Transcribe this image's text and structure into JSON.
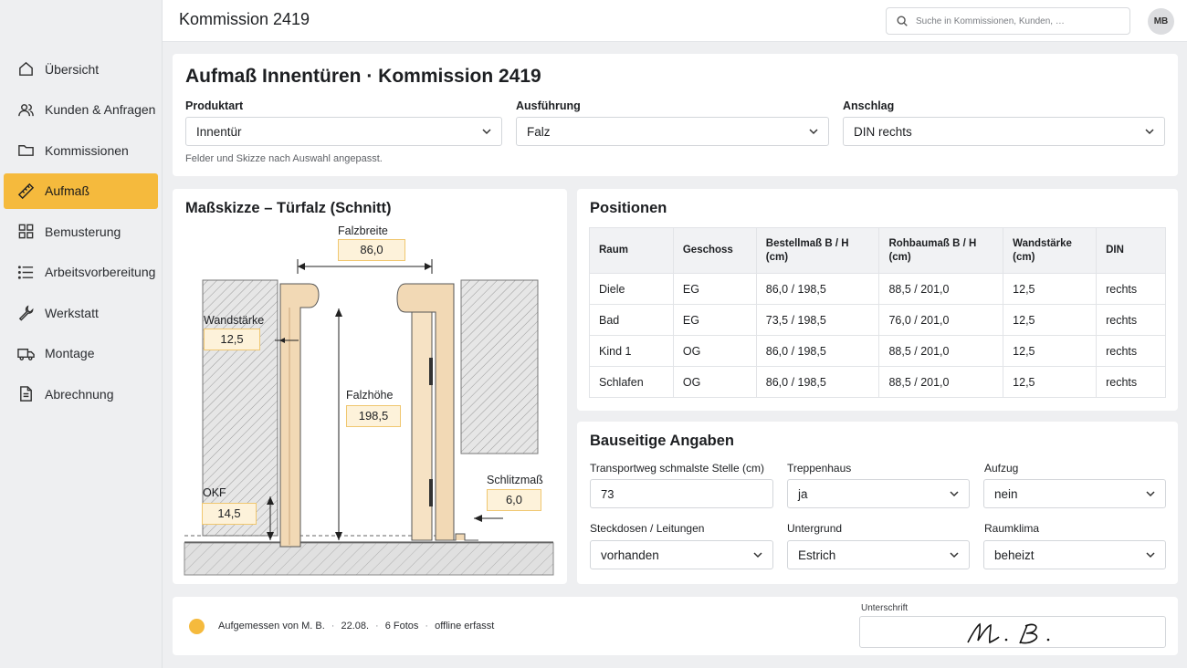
{
  "app": {
    "title": "Kommission 2419",
    "search_placeholder": "Suche in Kommissionen, Kunden, …",
    "avatar_initials": "MB",
    "accent_color": "#f5ba3d"
  },
  "sidebar": {
    "items": [
      {
        "label": "Übersicht",
        "icon": "home-icon"
      },
      {
        "label": "Kunden & Anfragen",
        "icon": "users-icon"
      },
      {
        "label": "Kommissionen",
        "icon": "folder-icon"
      },
      {
        "label": "Aufmaß",
        "icon": "ruler-icon",
        "active": true
      },
      {
        "label": "Bemusterung",
        "icon": "grid-icon"
      },
      {
        "label": "Arbeitsvorbereitung",
        "icon": "list-icon"
      },
      {
        "label": "Werkstatt",
        "icon": "wrench-icon"
      },
      {
        "label": "Montage",
        "icon": "truck-icon"
      },
      {
        "label": "Abrechnung",
        "icon": "document-icon"
      }
    ]
  },
  "header": {
    "page_title": "Aufmaß Innentüren · Kommission 2419",
    "produktart_label": "Produktart",
    "produktart_value": "Innentür",
    "ausfuehrung_label": "Ausführung",
    "ausfuehrung_value": "Falz",
    "anschlag_label": "Anschlag",
    "anschlag_value": "DIN rechts",
    "hint": "Felder und Skizze nach Auswahl angepasst."
  },
  "sketch": {
    "title": "Maßskizze – Türfalz (Schnitt)",
    "falzbreite_label": "Falzbreite",
    "falzbreite_value": "86,0",
    "wandstaerke_label": "Wandstärke",
    "wandstaerke_value": "12,5",
    "falzhoehe_label": "Falzhöhe",
    "falzhoehe_value": "198,5",
    "okf_label": "OKF",
    "okf_value": "14,5",
    "schlitzmass_label": "Schlitzmaß",
    "schlitzmass_value": "6,0"
  },
  "positions": {
    "title": "Positionen",
    "headers": [
      "Raum",
      "Geschoss",
      "Bestellmaß B / H (cm)",
      "Rohbaumaß B / H (cm)",
      "Wandstärke (cm)",
      "DIN"
    ],
    "rows": [
      [
        "Diele",
        "EG",
        "86,0 / 198,5",
        "88,5 / 201,0",
        "12,5",
        "rechts"
      ],
      [
        "Bad",
        "EG",
        "73,5 / 198,5",
        "76,0 / 201,0",
        "12,5",
        "rechts"
      ],
      [
        "Kind 1",
        "OG",
        "86,0 / 198,5",
        "88,5 / 201,0",
        "12,5",
        "rechts"
      ],
      [
        "Schlafen",
        "OG",
        "86,0 / 198,5",
        "88,5 / 201,0",
        "12,5",
        "rechts"
      ]
    ]
  },
  "bauseitig": {
    "title": "Bauseitige Angaben",
    "transportweg_label": "Transportweg schmalste Stelle (cm)",
    "transportweg_value": "73",
    "treppenhaus_label": "Treppenhaus",
    "treppenhaus_value": "ja",
    "aufzug_label": "Aufzug",
    "aufzug_value": "nein",
    "steckdosen_label": "Steckdosen / Leitungen",
    "steckdosen_value": "vorhanden",
    "untergrund_label": "Untergrund",
    "untergrund_value": "Estrich",
    "raumklima_label": "Raumklima",
    "raumklima_value": "beheizt"
  },
  "footer": {
    "measured_by": "Aufgemessen von M. B.",
    "date": "22.08.",
    "photos": "6 Fotos",
    "mode": "offline erfasst",
    "signature_label": "Unterschrift",
    "signature_text": "M. B."
  }
}
